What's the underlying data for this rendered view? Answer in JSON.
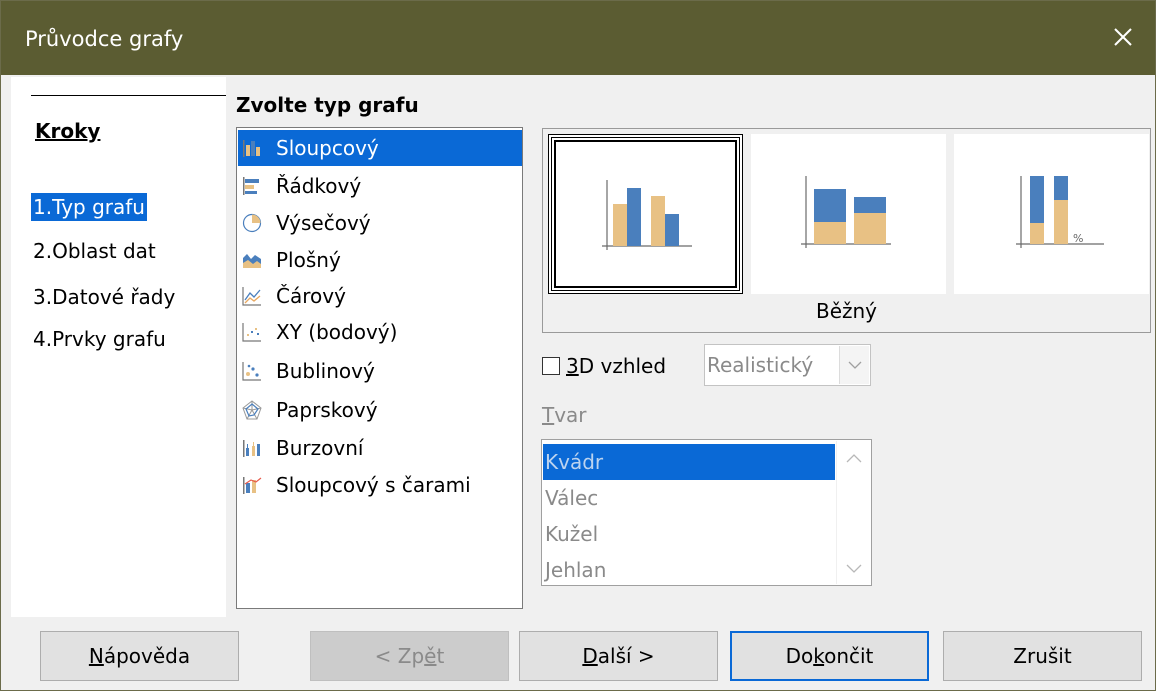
{
  "window": {
    "title": "Průvodce grafy"
  },
  "steps": {
    "heading": "Kroky",
    "items": [
      {
        "num": "1.",
        "label": "Typ grafu"
      },
      {
        "num": "2.",
        "label": "Oblast dat"
      },
      {
        "num": "3.",
        "label": "Datové řady"
      },
      {
        "num": "4.",
        "label": "Prvky grafu"
      }
    ]
  },
  "chart_type": {
    "heading": "Zvolte typ grafu",
    "types": [
      {
        "label": "Sloupcový",
        "icon": "column-chart-icon"
      },
      {
        "label": "Řádkový",
        "icon": "bar-chart-icon"
      },
      {
        "label": "Výsečový",
        "icon": "pie-chart-icon"
      },
      {
        "label": "Plošný",
        "icon": "area-chart-icon"
      },
      {
        "label": "Čárový",
        "icon": "line-chart-icon"
      },
      {
        "label": "XY (bodový)",
        "icon": "xy-scatter-icon"
      },
      {
        "label": "Bublinový",
        "icon": "bubble-chart-icon"
      },
      {
        "label": "Paprskový",
        "icon": "net-chart-icon"
      },
      {
        "label": "Burzovní",
        "icon": "stock-chart-icon"
      },
      {
        "label": "Sloupcový s čarami",
        "icon": "column-line-chart-icon"
      }
    ],
    "selected_index": 0,
    "variant_caption": "Běžný",
    "variant_percent_label": "%",
    "three_d": {
      "pre": "",
      "mnemonic": "3",
      "post": "D vzhled",
      "checked": false
    },
    "render_style": "Realistický",
    "shape": {
      "label_mnemonic": "T",
      "label_rest": "var",
      "options": [
        "Kvádr",
        "Válec",
        "Kužel",
        "Jehlan"
      ],
      "selected": "Kvádr"
    }
  },
  "buttons": {
    "help": {
      "mnemonic": "N",
      "rest": "ápověda"
    },
    "back": {
      "pre": "< Zp",
      "mnemonic": "ě",
      "post": "t"
    },
    "next": {
      "mnemonic": "D",
      "rest": "alší >"
    },
    "finish": {
      "pre": "Do",
      "mnemonic": "k",
      "post": "ončit"
    },
    "cancel": "Zrušit"
  },
  "colors": {
    "titlebar": "#5b5c32",
    "selection": "#0a69d6",
    "bar_orange": "#e8c184",
    "bar_blue": "#4a7fbd"
  }
}
